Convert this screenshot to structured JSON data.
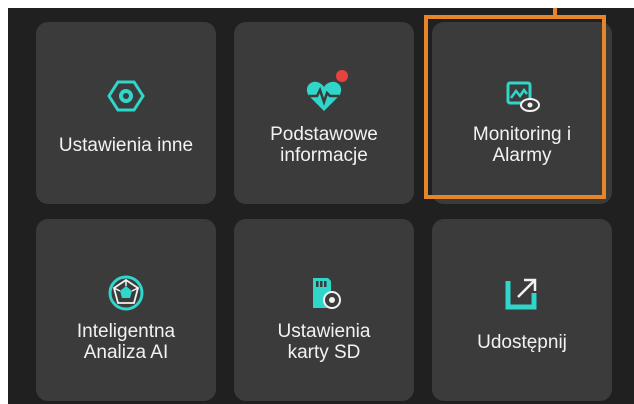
{
  "colors": {
    "background": "#202020",
    "tile": "#3b3b3b",
    "accent": "#2fd6c9",
    "highlight": "#e6852a",
    "badge": "#e8423f"
  },
  "tiles": [
    {
      "label": "Ustawienia inne",
      "icon": "settings-hexagon-icon",
      "highlighted": false
    },
    {
      "label": "Podstawowe\ninformacje",
      "icon": "heart-pulse-icon",
      "highlighted": false,
      "badge": true
    },
    {
      "label": "Monitoring i\nAlarmy",
      "icon": "monitoring-eye-icon",
      "highlighted": true
    },
    {
      "label": "Inteligentna\nAnaliza AI",
      "icon": "ai-polygon-icon",
      "highlighted": false
    },
    {
      "label": "Ustawienia\nkarty SD",
      "icon": "sd-card-settings-icon",
      "highlighted": false
    },
    {
      "label": "Udostępnij",
      "icon": "share-icon",
      "highlighted": false
    }
  ]
}
